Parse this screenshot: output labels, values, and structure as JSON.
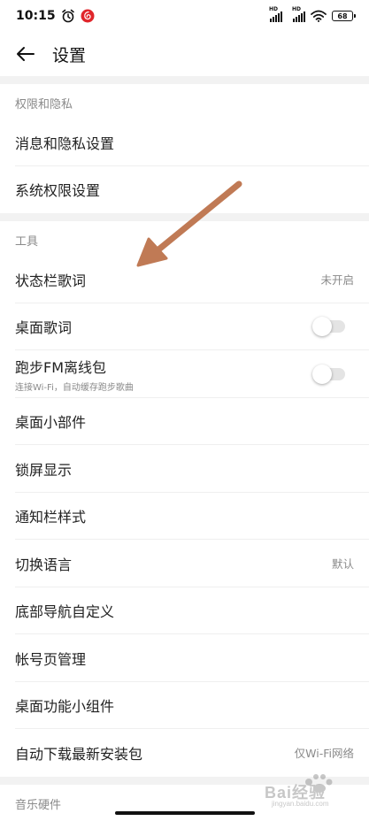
{
  "status_bar": {
    "time": "10:15",
    "battery": "68",
    "signal_label": "HD"
  },
  "header": {
    "title": "设置"
  },
  "sections": [
    {
      "title": "权限和隐私",
      "items": [
        {
          "label": "消息和隐私设置"
        },
        {
          "label": "系统权限设置"
        }
      ]
    },
    {
      "title": "工具",
      "items": [
        {
          "label": "状态栏歌词",
          "value": "未开启"
        },
        {
          "label": "桌面歌词",
          "toggle": false
        },
        {
          "label": "跑步FM离线包",
          "sublabel": "连接Wi-Fi，自动缓存跑步歌曲",
          "toggle": false
        },
        {
          "label": "桌面小部件"
        },
        {
          "label": "锁屏显示"
        },
        {
          "label": "通知栏样式"
        },
        {
          "label": "切换语言",
          "value": "默认"
        },
        {
          "label": "底部导航自定义"
        },
        {
          "label": "帐号页管理"
        },
        {
          "label": "桌面功能小组件"
        },
        {
          "label": "自动下载最新安装包",
          "value": "仅Wi-Fi网络"
        }
      ]
    },
    {
      "title": "音乐硬件",
      "items": []
    }
  ],
  "watermark": {
    "text": "Bai经验",
    "url_text": "jingyan.baidu.com"
  },
  "colors": {
    "accent_arrow": "#c07a55",
    "notif_app": "#e0262b",
    "divider": "#efefef",
    "section_bg": "#f2f2f2"
  }
}
